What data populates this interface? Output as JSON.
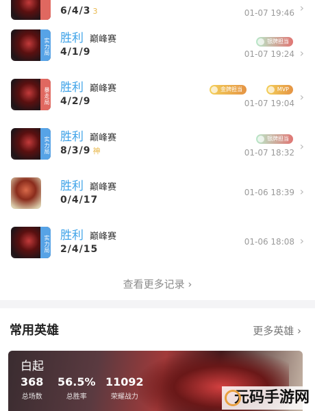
{
  "matches": [
    {
      "result": "",
      "mode": "",
      "kda": "6/4/3",
      "god_mark": "3",
      "time": "01-07 19:46",
      "badge": "",
      "avatar": "dark",
      "tags": []
    },
    {
      "result": "胜利",
      "mode": "巅峰赛",
      "kda": "4/1/9",
      "god_mark": "",
      "time": "01-07 19:24",
      "badge": "实力局",
      "avatar": "dark",
      "tags": [
        "银牌担当"
      ]
    },
    {
      "result": "胜利",
      "mode": "巅峰赛",
      "kda": "4/2/9",
      "god_mark": "",
      "time": "01-07 19:04",
      "badge": "暴走局",
      "avatar": "dark",
      "tags": [
        "金牌担当",
        "MVP"
      ]
    },
    {
      "result": "胜利",
      "mode": "巅峰赛",
      "kda": "8/3/9",
      "god_mark": "神",
      "time": "01-07 18:32",
      "badge": "实力局",
      "avatar": "dark",
      "tags": [
        "银牌担当"
      ]
    },
    {
      "result": "胜利",
      "mode": "巅峰赛",
      "kda": "0/4/17",
      "god_mark": "",
      "time": "01-06 18:39",
      "badge": "",
      "avatar": "golden",
      "tags": []
    },
    {
      "result": "胜利",
      "mode": "巅峰赛",
      "kda": "2/4/15",
      "god_mark": "",
      "time": "01-06 18:08",
      "badge": "实力局",
      "avatar": "dark",
      "tags": []
    }
  ],
  "more_records": "查看更多记录 ›",
  "section": {
    "title": "常用英雄",
    "more": "更多英雄 ›"
  },
  "hero": {
    "name": "白起",
    "stats": [
      {
        "value": "368",
        "label": "总场数"
      },
      {
        "value": "56.5%",
        "label": "总胜率"
      },
      {
        "value": "11092",
        "label": "荣耀战力"
      }
    ]
  },
  "watermark": "元码手游网",
  "colors": {
    "win": "#3fa3e8",
    "badge_blue": "#57a3e6",
    "badge_red": "#e06860"
  }
}
